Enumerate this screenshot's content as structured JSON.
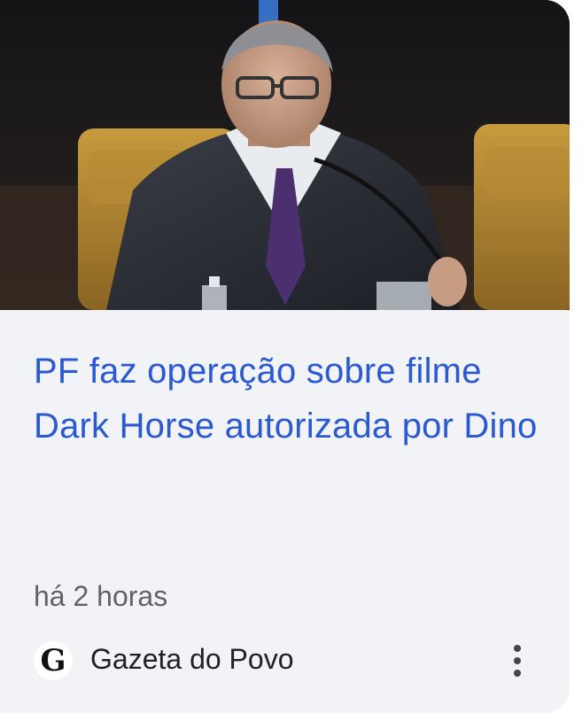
{
  "article": {
    "headline": "PF faz operação sobre filme Dark Horse autorizada por Dino",
    "timestamp": "há 2 horas",
    "thumbnail_alt": "Flávio Dino"
  },
  "source": {
    "logo_letter": "G",
    "name": "Gazeta do Povo"
  },
  "actions": {
    "more_icon": "more-vert-icon"
  },
  "colors": {
    "headline": "#2a59d0",
    "card_background": "#f2f3f6",
    "secondary_text": "#5f6368"
  }
}
